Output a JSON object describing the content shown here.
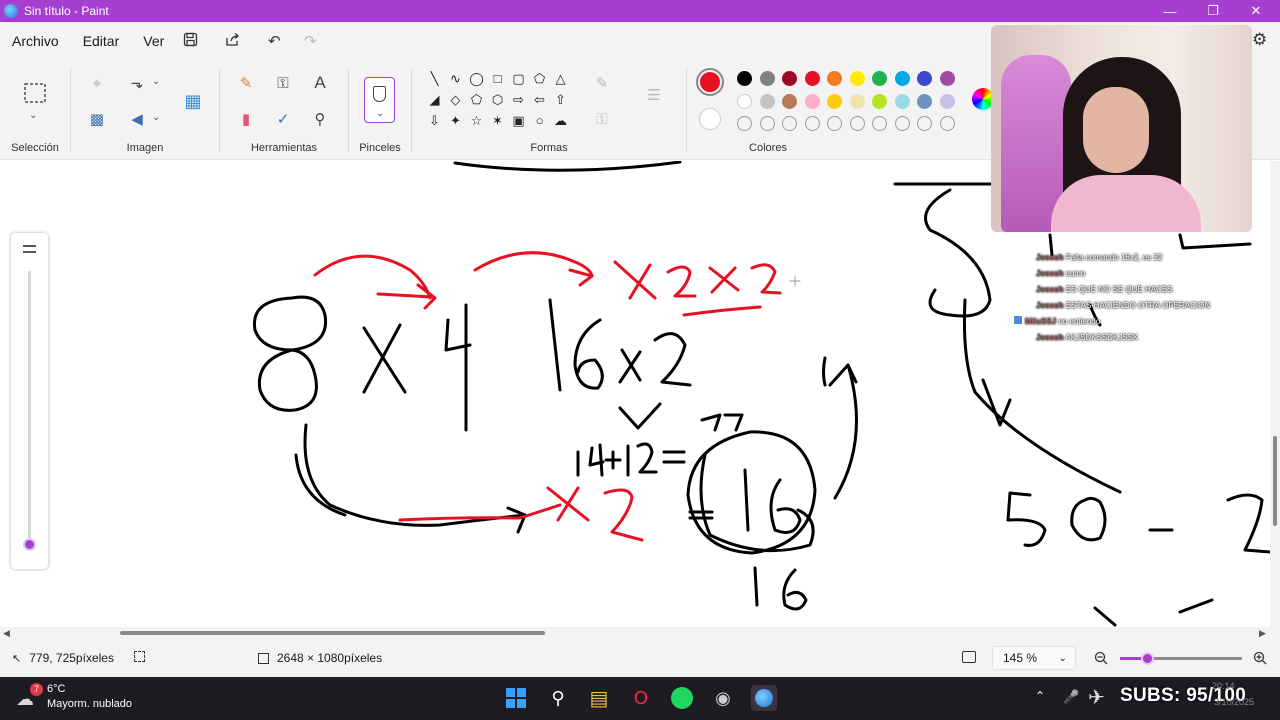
{
  "window": {
    "title": "Sin título - Paint"
  },
  "menu": {
    "archivo": "Archivo",
    "editar": "Editar",
    "ver": "Ver"
  },
  "ribbon": {
    "seleccion": "Selección",
    "imagen": "Imagen",
    "herramientas": "Herramientas",
    "pinceles": "Pinceles",
    "formas": "Formas",
    "colores": "Colores"
  },
  "colors": {
    "primary": "#e81123",
    "secondary": "#ffffff",
    "accent": "#a63fd1",
    "row1": [
      "#000000",
      "#808080",
      "#9b0a2a",
      "#e81123",
      "#f47920",
      "#ffeb00",
      "#22b14c",
      "#00a8e8",
      "#3f48cc",
      "#a349a4"
    ],
    "row2": [
      "#ffffff",
      "#c3c3c3",
      "#b97a57",
      "#ffaec9",
      "#ffc90e",
      "#efe4b0",
      "#b5e61d",
      "#99d9ea",
      "#7092be",
      "#c8bfe7"
    ]
  },
  "chat": [
    {
      "user": "Jeeeoh",
      "msg": "Falta comando 16x2, es 32"
    },
    {
      "user": "Jeeeoh",
      "msg": "sumo"
    },
    {
      "user": "Jeeeoh",
      "msg": "ES QUE NO SE QUE HACES"
    },
    {
      "user": "Jeeeoh",
      "msg": "ESTAS HACIENDO OTRA OPERACION"
    },
    {
      "user": "MiluSSJ",
      "msg": "no entiendo"
    },
    {
      "user": "Jeeeoh",
      "msg": "AKJSDKSSDKJSSK"
    }
  ],
  "status": {
    "cursor_pos": "779, 725píxeles",
    "canvas_size": "2648 × 1080píxeles",
    "zoom": "145 %",
    "zoom_level": 0.45
  },
  "taskbar": {
    "weather_temp": "6°C",
    "weather_desc": "Mayorm. nublado",
    "subs": "SUBS: 95/100",
    "time": "20:14",
    "date": "3/10/2025"
  }
}
